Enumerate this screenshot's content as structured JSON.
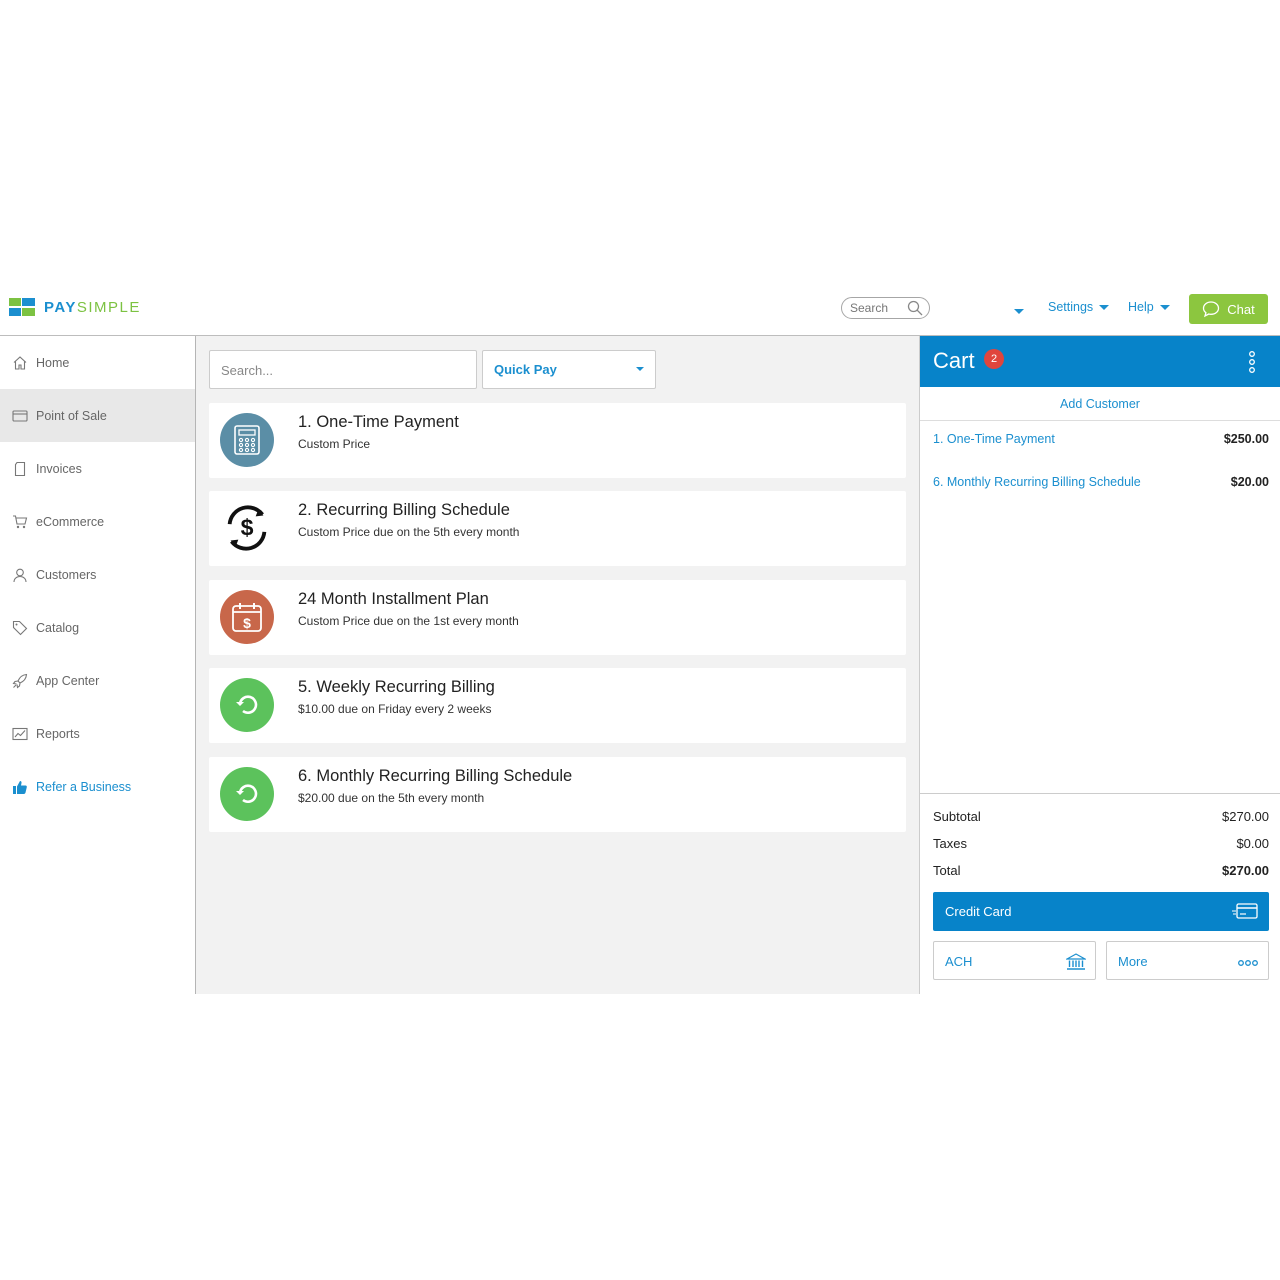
{
  "header": {
    "brand_pay": "PAY",
    "brand_simple": "SIMPLE",
    "search_label": "Search",
    "settings_label": "Settings",
    "help_label": "Help",
    "chat_label": "Chat"
  },
  "sidebar": {
    "items": [
      {
        "label": "Home",
        "icon": "home-icon"
      },
      {
        "label": "Point of Sale",
        "icon": "card-icon"
      },
      {
        "label": "Invoices",
        "icon": "document-icon"
      },
      {
        "label": "eCommerce",
        "icon": "cart-icon"
      },
      {
        "label": "Customers",
        "icon": "user-icon"
      },
      {
        "label": "Catalog",
        "icon": "tag-icon"
      },
      {
        "label": "App Center",
        "icon": "rocket-icon"
      },
      {
        "label": "Reports",
        "icon": "chart-icon"
      },
      {
        "label": "Refer a Business",
        "icon": "thumbs-up-icon"
      }
    ]
  },
  "main": {
    "search_placeholder": "Search...",
    "filter_selected": "Quick Pay",
    "items": [
      {
        "title": "1. One-Time Payment",
        "subtitle": "Custom Price",
        "icon": "calculator-icon",
        "color": "#5b8ea6"
      },
      {
        "title": "2. Recurring Billing Schedule",
        "subtitle": "Custom Price due on the 5th every month",
        "icon": "recurring-dollar-icon",
        "color": "#ffffff"
      },
      {
        "title": "24 Month Installment Plan",
        "subtitle": "Custom Price due on the 1st every month",
        "icon": "calendar-dollar-icon",
        "color": "#c8674a"
      },
      {
        "title": "5. Weekly Recurring Billing",
        "subtitle": "$10.00 due on Friday every 2 weeks",
        "icon": "refresh-icon",
        "color": "#5cc25c"
      },
      {
        "title": "6. Monthly Recurring Billing Schedule",
        "subtitle": "$20.00 due on the 5th every month",
        "icon": "refresh-icon",
        "color": "#5cc25c"
      }
    ]
  },
  "cart": {
    "title": "Cart",
    "count": "2",
    "add_customer": "Add Customer",
    "lines": [
      {
        "name": "1. One-Time Payment",
        "amount": "$250.00"
      },
      {
        "name": "6. Monthly Recurring Billing Schedule",
        "amount": "$20.00"
      }
    ],
    "subtotal_label": "Subtotal",
    "subtotal": "$270.00",
    "taxes_label": "Taxes",
    "taxes": "$0.00",
    "total_label": "Total",
    "total": "$270.00",
    "credit_card_label": "Credit Card",
    "ach_label": "ACH",
    "more_label": "More"
  },
  "colors": {
    "accent": "#0783c9",
    "link": "#1b8fcf",
    "chat_green": "#8cc63f",
    "badge_red": "#e0453d"
  }
}
